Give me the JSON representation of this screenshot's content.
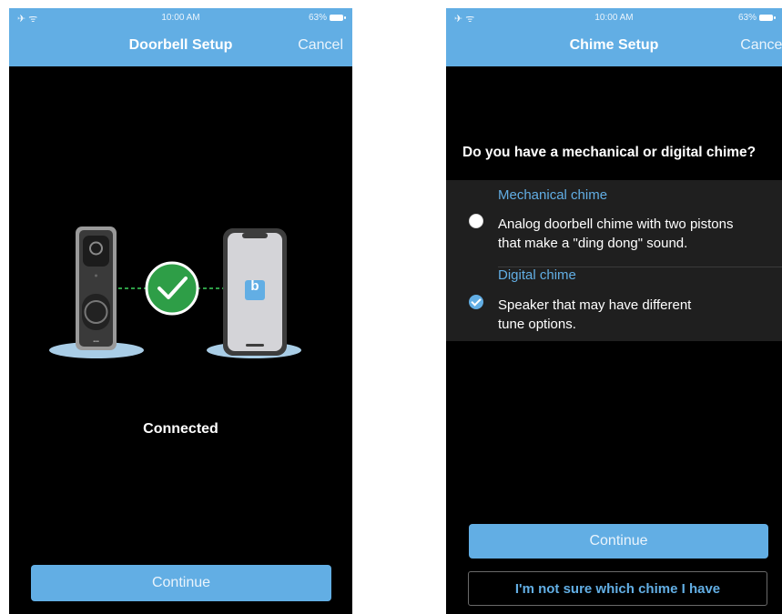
{
  "left_screen": {
    "status": {
      "time": "10:00 AM",
      "battery": "63%"
    },
    "header": {
      "title": "Doorbell Setup",
      "cancel_label": "Cancel"
    },
    "illustration": {
      "app_letter": "b"
    },
    "status_text": "Connected",
    "continue_label": "Continue"
  },
  "right_screen": {
    "status": {
      "time": "10:00 AM",
      "battery": "63%"
    },
    "header": {
      "title": "Chime Setup",
      "cancel_label": "Cancel"
    },
    "question": "Do you have a mechanical or digital chime?",
    "options": [
      {
        "title": "Mechanical chime",
        "desc_line1": "Analog doorbell chime with two pistons",
        "desc_line2": "that make a \"ding dong\" sound.",
        "selected": false
      },
      {
        "title": "Digital chime",
        "desc_line1": "Speaker that may have different",
        "desc_line2": "tune options.",
        "selected": true
      }
    ],
    "continue_label": "Continue",
    "not_sure_label": "I'm not sure which chime I have"
  },
  "colors": {
    "accent": "#62aee4",
    "success": "#2e9e47",
    "background": "#000000"
  },
  "icons": [
    "airplane-icon",
    "wifi-icon",
    "battery-icon",
    "doorbell-icon",
    "checkmark-icon",
    "phone-icon",
    "radio-button-icon"
  ]
}
